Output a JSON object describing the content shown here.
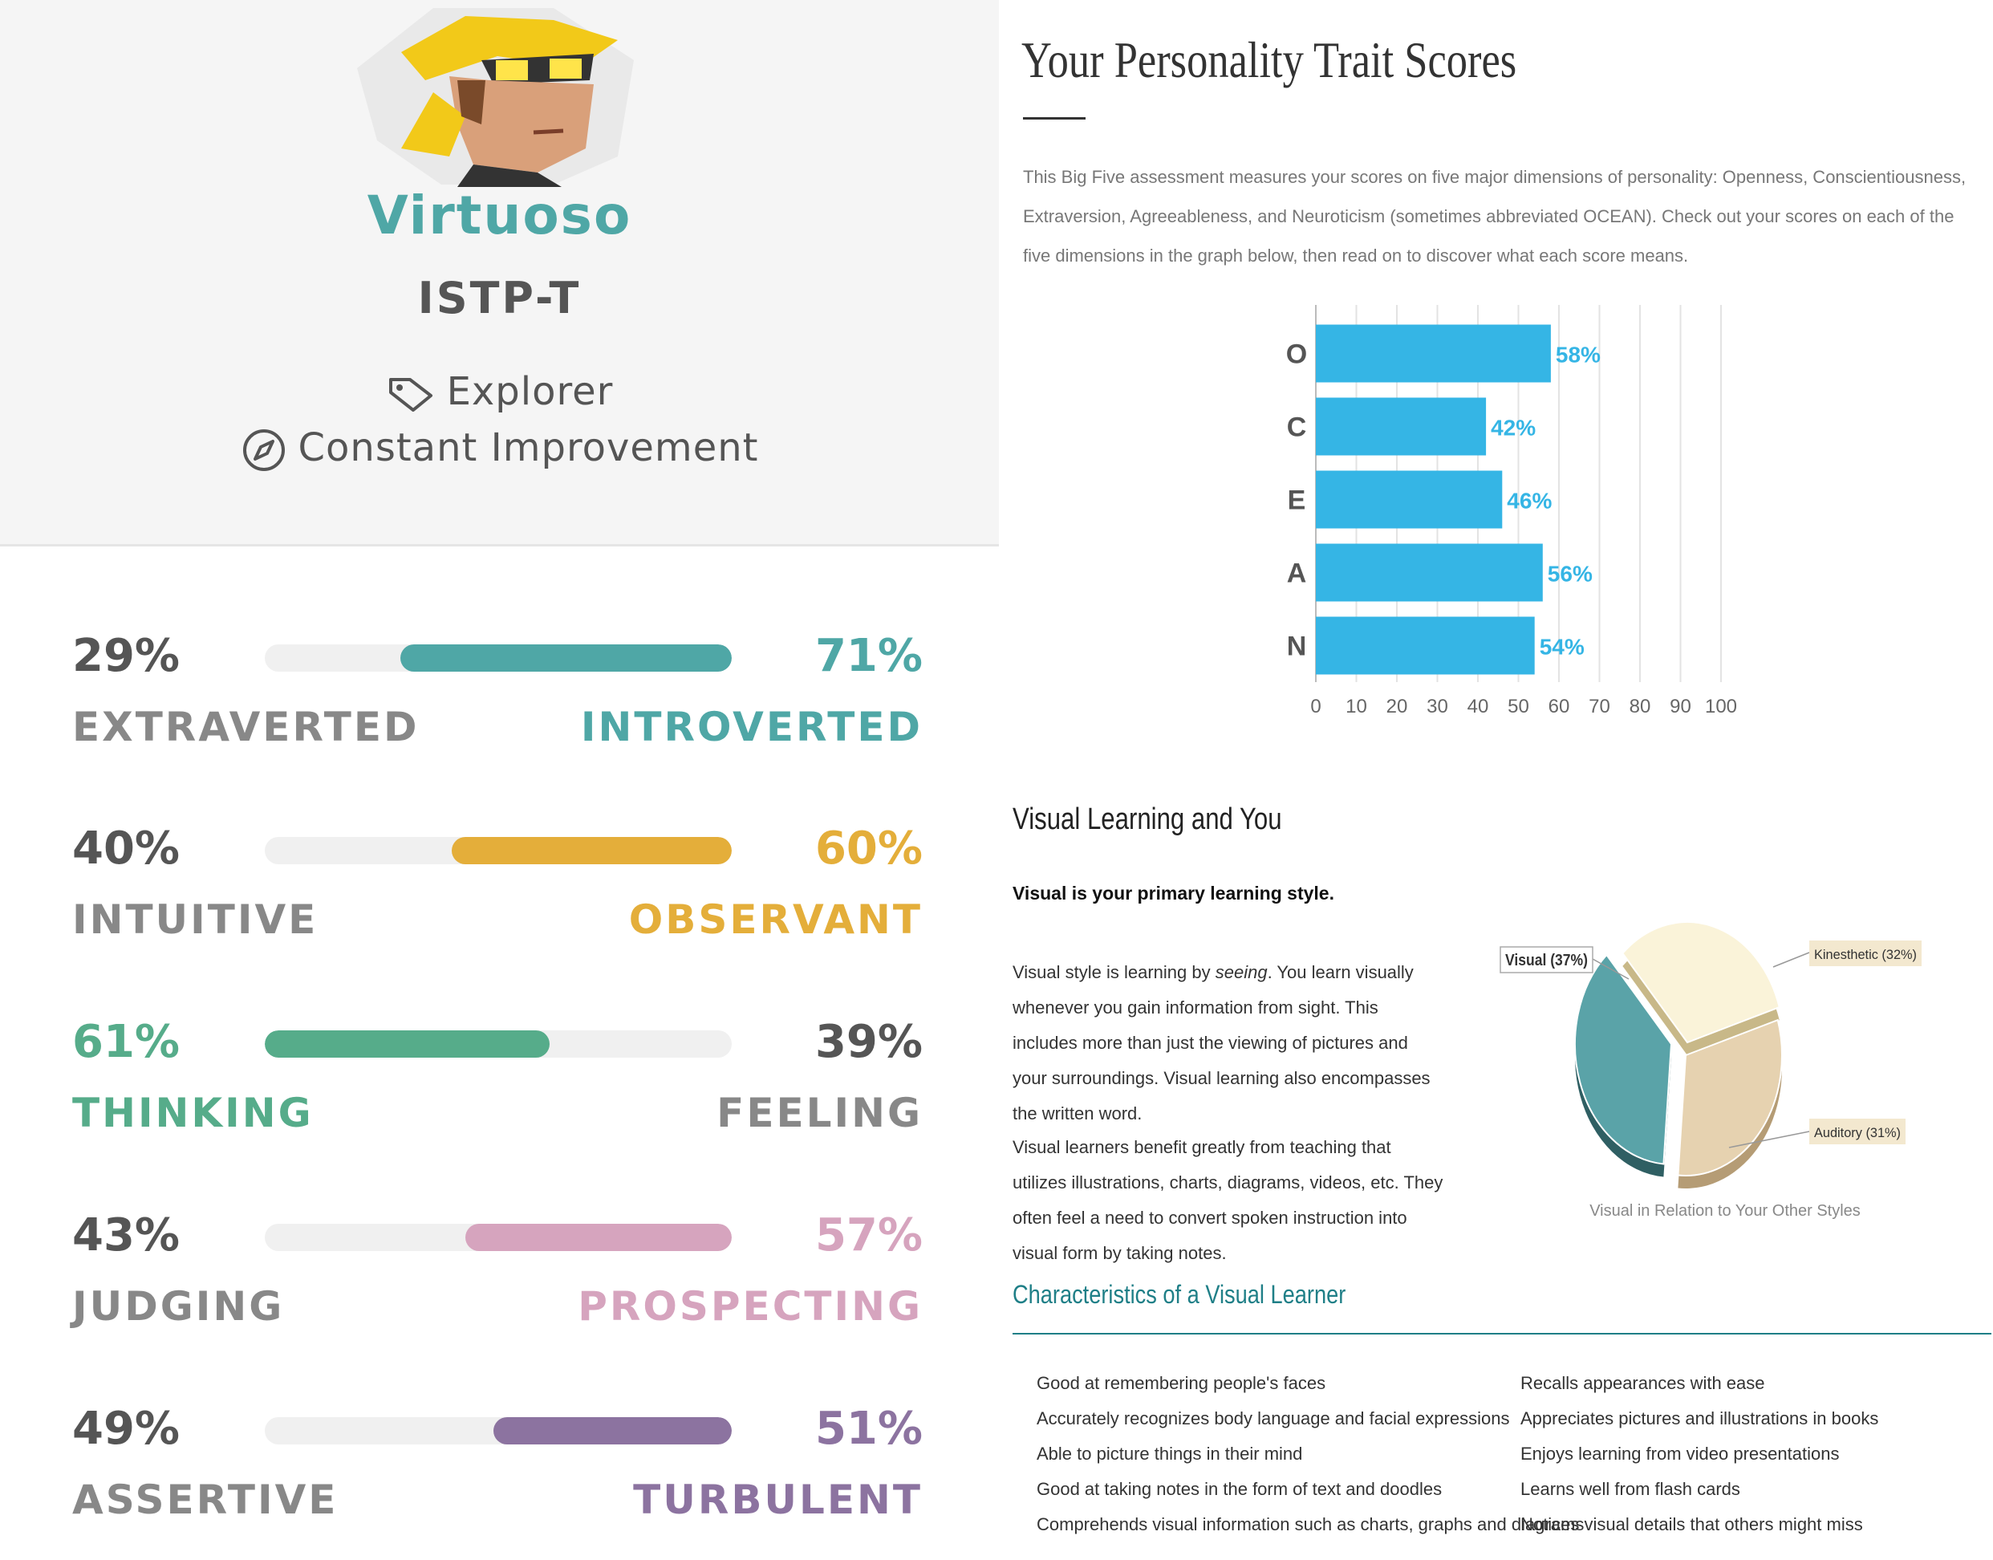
{
  "profile": {
    "type_name": "Virtuoso",
    "type_code": "ISTP-T",
    "role": "Explorer",
    "strategy": "Constant Improvement",
    "role_icon": "tag-icon",
    "strategy_icon": "compass-icon"
  },
  "traits": [
    {
      "left_pct": "29%",
      "right_pct": "71%",
      "left_label": "EXTRAVERTED",
      "right_label": "INTROVERTED",
      "dominant": "right",
      "value": 71,
      "color": "#4fa7a6"
    },
    {
      "left_pct": "40%",
      "right_pct": "60%",
      "left_label": "INTUITIVE",
      "right_label": "OBSERVANT",
      "dominant": "right",
      "value": 60,
      "color": "#e4ae3a"
    },
    {
      "left_pct": "61%",
      "right_pct": "39%",
      "left_label": "THINKING",
      "right_label": "FEELING",
      "dominant": "left",
      "value": 61,
      "color": "#56ac8a"
    },
    {
      "left_pct": "43%",
      "right_pct": "57%",
      "left_label": "JUDGING",
      "right_label": "PROSPECTING",
      "dominant": "right",
      "value": 57,
      "color": "#d6a4be"
    },
    {
      "left_pct": "49%",
      "right_pct": "51%",
      "left_label": "ASSERTIVE",
      "right_label": "TURBULENT",
      "dominant": "right",
      "value": 51,
      "color": "#8c73a0"
    }
  ],
  "ocean": {
    "title": "Your Personality Trait Scores",
    "description": "This Big Five assessment measures your scores on five major dimensions of personality: Openness, Conscientiousness, Extraversion, Agreeableness, and Neuroticism (sometimes abbreviated OCEAN). Check out your scores on each of the five dimensions in the graph below, then read on to discover what each score means."
  },
  "visual_learning": {
    "title": "Visual Learning and You",
    "subtitle": "Visual is your primary learning style.",
    "p1_before": "Visual style is learning by ",
    "p1_em": "seeing",
    "p1_after": ". You learn visually whenever you gain information from sight. This includes more than just the viewing of pictures and your surroundings. Visual learning also encompasses the written word.",
    "p2": "Visual learners benefit greatly from teaching that utilizes illustrations, charts, diagrams, videos, etc. They often feel a need to convert spoken instruction into visual form by taking notes.",
    "pie_caption": "Visual in Relation to Your Other Styles"
  },
  "characteristics": {
    "title": "Characteristics of a Visual Learner",
    "left": [
      "Good at remembering people's faces",
      "Accurately recognizes body language and facial expressions",
      "Able to picture things in their mind",
      "Good at taking notes in the form of text and doodles",
      "Comprehends visual information such as charts, graphs and diagrams"
    ],
    "right": [
      "Recalls appearances with ease",
      "Appreciates pictures and illustrations in books",
      "Enjoys learning from video presentations",
      "Learns well from flash cards",
      "Notices visual details that others might miss"
    ]
  },
  "colors": {
    "bar_blue": "#35b5e5",
    "pie_visual": "#5aa3a8",
    "pie_kinesthetic": "#faf3d9",
    "pie_auditory": "#e6d2b0",
    "accent_teal": "#1f7f87"
  },
  "chart_data": [
    {
      "type": "bar",
      "orientation": "horizontal",
      "categories": [
        "O",
        "C",
        "E",
        "A",
        "N"
      ],
      "values": [
        58,
        42,
        46,
        56,
        54
      ],
      "data_labels": [
        "58%",
        "42%",
        "46%",
        "56%",
        "54%"
      ],
      "xlim": [
        0,
        100
      ],
      "x_ticks": [
        "0",
        "10",
        "20",
        "30",
        "40",
        "50",
        "60",
        "70",
        "80",
        "90",
        "100"
      ],
      "grid": "vertical"
    },
    {
      "type": "pie",
      "slices": [
        {
          "label": "Visual (37%)",
          "value": 37
        },
        {
          "label": "Kinesthetic (32%)",
          "value": 32
        },
        {
          "label": "Auditory (31%)",
          "value": 31
        }
      ]
    }
  ]
}
